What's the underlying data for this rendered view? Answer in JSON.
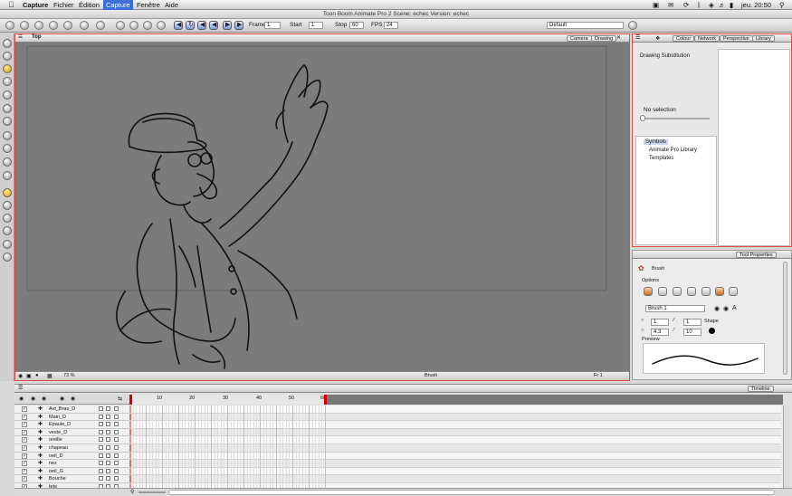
{
  "menubar": {
    "apple": "",
    "items": [
      "Capture",
      "Fichier",
      "Édition",
      "Capture",
      "Fenêtre",
      "Aide"
    ],
    "clock": "jeu. 20:50"
  },
  "window": {
    "title": "Toon Boom Animate Pro 2 Scene: echec Version: echec"
  },
  "toolbar": {
    "frame_label": "Frame",
    "frame_value": "1",
    "start_label": "Start",
    "start_value": "1",
    "stop_label": "Stop",
    "stop_value": "60",
    "fps_label": "FPS",
    "fps_value": "24",
    "workspace_value": "Default"
  },
  "view": {
    "title": "Top",
    "tabs": [
      "Camera",
      "Drawing"
    ],
    "zoom": "73 %",
    "tool_status": "Brush",
    "frame_status": "Fr 1"
  },
  "right_panel": {
    "tabs": [
      "Colour",
      "Network",
      "Perspective",
      "Library"
    ],
    "heading": "Drawing Substitution",
    "no_selection": "No selection",
    "library_items": [
      "Symbols",
      "Animate Pro Library",
      "Templates"
    ]
  },
  "tool_properties": {
    "tab": "Tool Properties",
    "tool_name": "Brush",
    "options_label": "Options",
    "brush_preset": "Brush 1",
    "min_size": "1",
    "max_size": "1",
    "shape_label": "Shape",
    "smoothness": "4.3",
    "contour_smoothness": "10",
    "preview_label": "Preview"
  },
  "timeline": {
    "tab": "Timeline",
    "ruler": [
      "10",
      "20",
      "30",
      "40",
      "50",
      "60"
    ],
    "layers": [
      "Avt_Bras_D",
      "Main_D",
      "Epaule_D",
      "veste_D",
      "oreille",
      "chapeau",
      "oeil_D",
      "nez",
      "oeil_G",
      "Bouche",
      "tete"
    ],
    "checkmark": "✓"
  },
  "colors": {
    "accent_red": "#e24a4a",
    "menu_highlight": "#3d6fd6",
    "canvas": "#7b7b7b",
    "playhead": "#d40000"
  }
}
